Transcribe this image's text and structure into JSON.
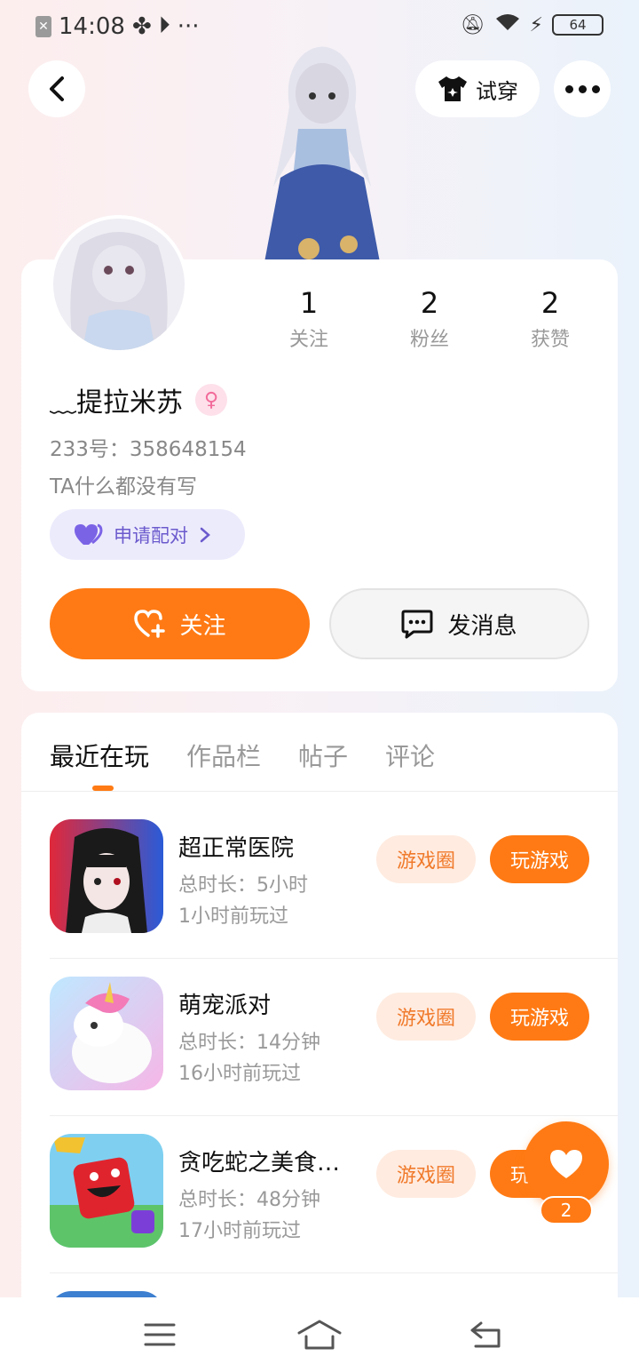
{
  "status_bar": {
    "time": "14:08",
    "battery": "64"
  },
  "header": {
    "tryon_label": "试穿"
  },
  "profile": {
    "stats": [
      {
        "value": "1",
        "label": "关注"
      },
      {
        "value": "2",
        "label": "粉丝"
      },
      {
        "value": "2",
        "label": "获赞"
      }
    ],
    "username": "﹏提拉米苏",
    "gender_symbol": "♀",
    "uid": "233号：358648154",
    "bio": "TA什么都没有写",
    "pair_label": "申请配对",
    "follow_label": "关注",
    "message_label": "发消息"
  },
  "tabs": [
    {
      "label": "最近在玩",
      "active": true
    },
    {
      "label": "作品栏",
      "active": false
    },
    {
      "label": "帖子",
      "active": false
    },
    {
      "label": "评论",
      "active": false
    }
  ],
  "games": [
    {
      "name": "超正常医院",
      "duration": "总时长：5小时",
      "last_played": "1小时前玩过",
      "circle_label": "游戏圈",
      "play_label": "玩游戏"
    },
    {
      "name": "萌宠派对",
      "duration": "总时长：14分钟",
      "last_played": "16小时前玩过",
      "circle_label": "游戏圈",
      "play_label": "玩游戏"
    },
    {
      "name": "贪吃蛇之美食…",
      "duration": "总时长：48分钟",
      "last_played": "17小时前玩过",
      "circle_label": "游戏圈",
      "play_label": "玩游戏"
    }
  ],
  "fab": {
    "like_count": "2"
  },
  "colors": {
    "accent": "#ff7a14",
    "accent_light": "#ffebe0",
    "pair_bg": "#ecebfc",
    "pair_text": "#6a5acd"
  }
}
